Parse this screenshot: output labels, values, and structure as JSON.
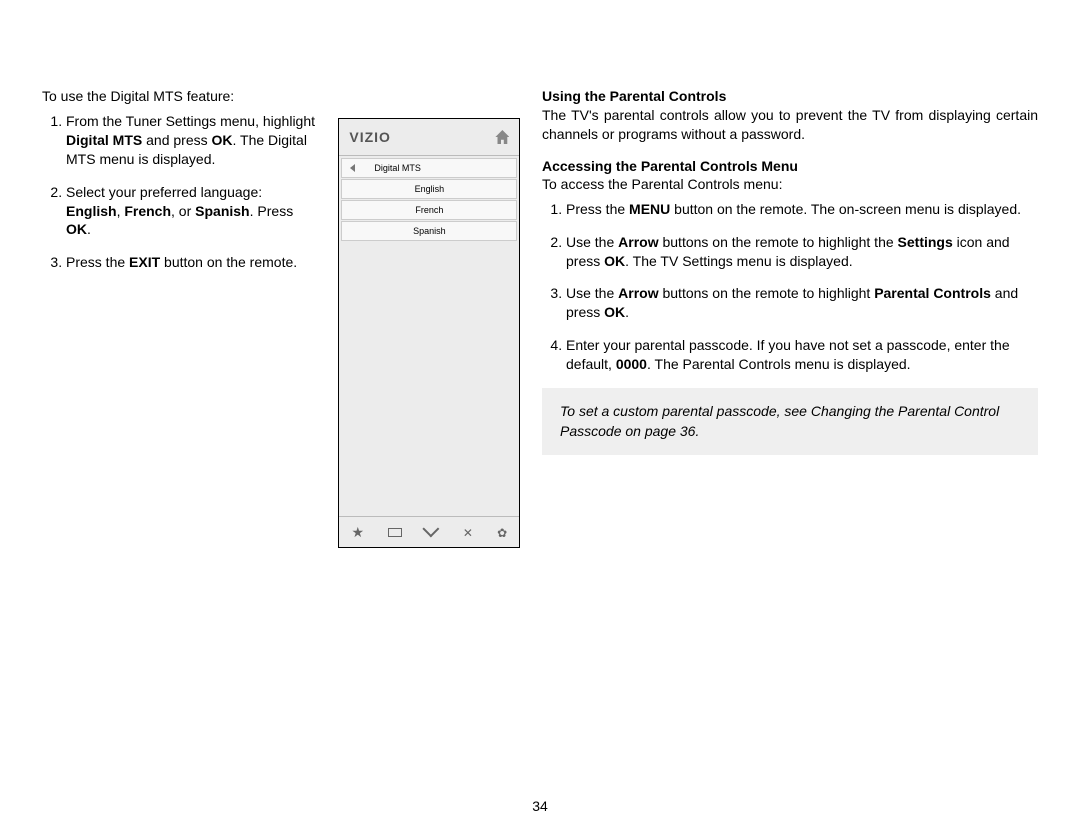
{
  "left": {
    "intro": "To use the Digital MTS feature:",
    "steps": [
      "From the Tuner Settings menu, highlight <strong>Digital MTS</strong> and press <strong>OK</strong>. The Digital MTS menu is displayed.",
      "Select your preferred language: <strong>English</strong>, <strong>French</strong>, or <strong>Spanish</strong>. Press <strong>OK</strong>.",
      "Press the <strong>EXIT</strong> button on the remote."
    ]
  },
  "tv": {
    "brand": "VIZIO",
    "title": "Digital MTS",
    "options": [
      "English",
      "French",
      "Spanish"
    ],
    "icons": [
      "star-icon",
      "rect-icon",
      "chevrons-down-icon",
      "x-icon",
      "gear-icon"
    ]
  },
  "right": {
    "h1": "Using the Parental Controls",
    "p1": "The TV's parental controls allow you to prevent the TV from displaying certain channels or programs without a password.",
    "h2": "Accessing the Parental Controls Menu",
    "p2": "To access the Parental Controls menu:",
    "steps": [
      "Press the <strong>MENU</strong> button on the remote. The on-screen menu is displayed.",
      "Use the <strong>Arrow</strong> buttons on the remote to highlight the <strong>Settings</strong> icon and press <strong>OK</strong>. The TV Settings menu is displayed.",
      "Use the <strong>Arrow</strong> buttons on the remote to highlight <strong>Parental Controls</strong> and press <strong>OK</strong>.",
      "Enter your parental passcode. If you have not set a passcode, enter the default, <strong>0000</strong>. The Parental Controls menu is displayed."
    ],
    "note_pre": "To set a custom parental passcode, see ",
    "note_ref": "Changing the Parental Control Passcode",
    "note_post": " on page 36."
  },
  "page_number": "34"
}
